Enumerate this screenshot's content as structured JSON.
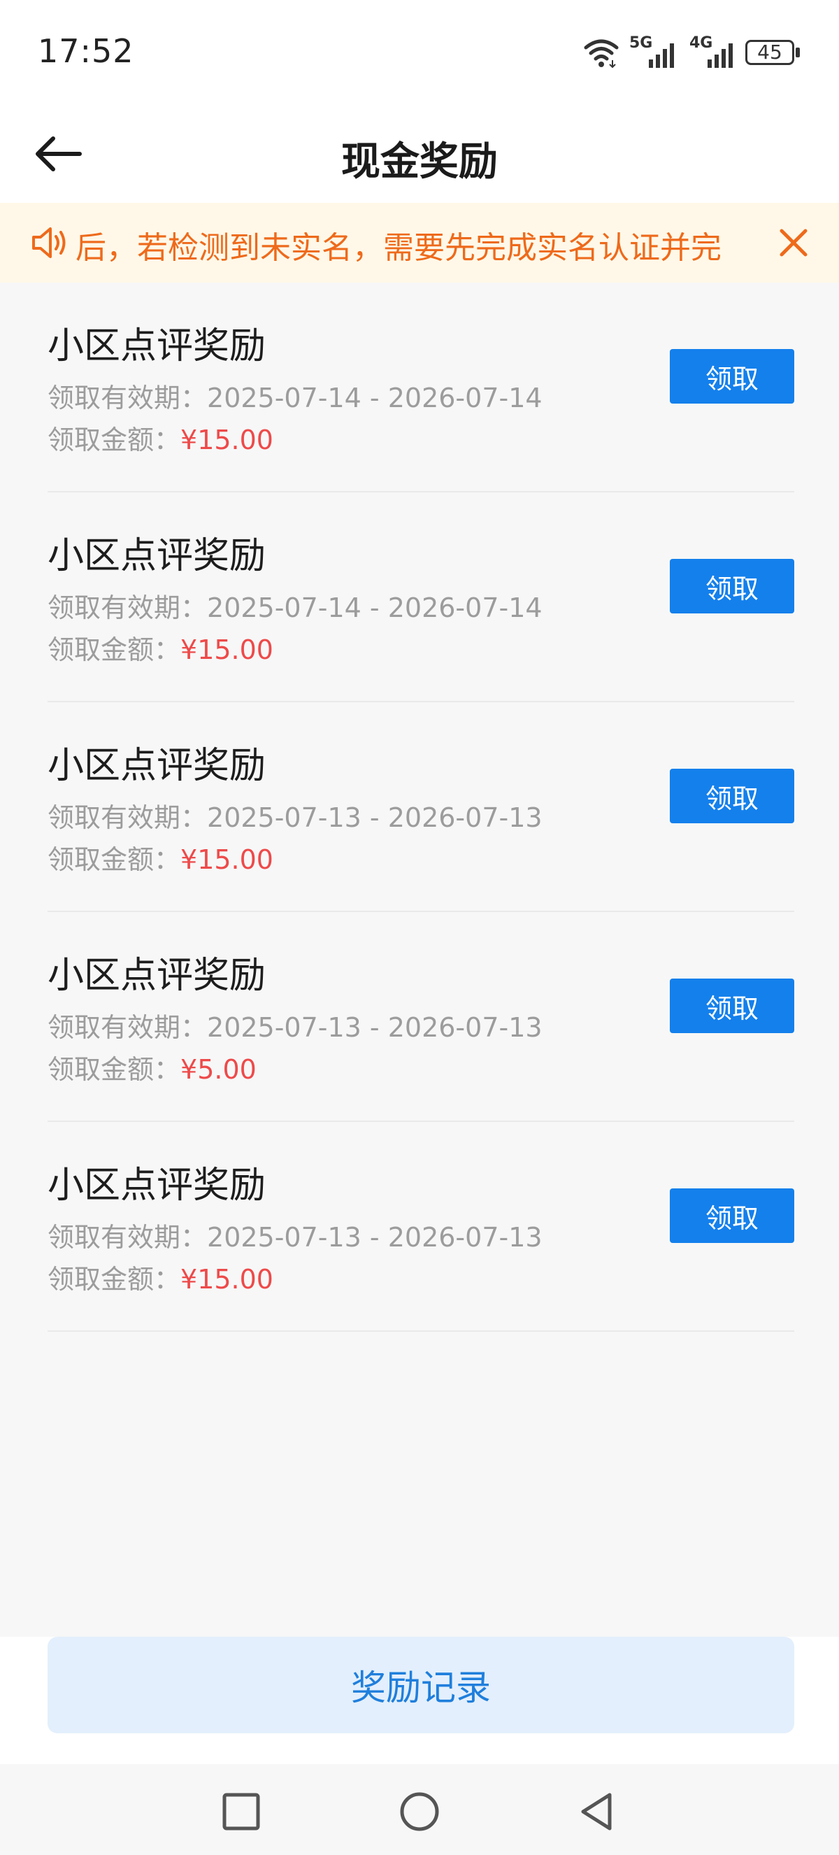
{
  "status": {
    "time": "17:52",
    "network_1": "5G",
    "network_2": "4G",
    "battery": "45"
  },
  "header": {
    "title": "现金奖励"
  },
  "notice": {
    "text": "后，若检测到未实名，需要先完成实名认证并完"
  },
  "rewards": [
    {
      "title": "小区点评奖励",
      "validity_label": "领取有效期：",
      "validity": "2025-07-14 - 2026-07-14",
      "amount_label": "领取金额：",
      "amount": "¥15.00",
      "button": "领取"
    },
    {
      "title": "小区点评奖励",
      "validity_label": "领取有效期：",
      "validity": "2025-07-14 - 2026-07-14",
      "amount_label": "领取金额：",
      "amount": "¥15.00",
      "button": "领取"
    },
    {
      "title": "小区点评奖励",
      "validity_label": "领取有效期：",
      "validity": "2025-07-13 - 2026-07-13",
      "amount_label": "领取金额：",
      "amount": "¥15.00",
      "button": "领取"
    },
    {
      "title": "小区点评奖励",
      "validity_label": "领取有效期：",
      "validity": "2025-07-13 - 2026-07-13",
      "amount_label": "领取金额：",
      "amount": "¥5.00",
      "button": "领取"
    },
    {
      "title": "小区点评奖励",
      "validity_label": "领取有效期：",
      "validity": "2025-07-13 - 2026-07-13",
      "amount_label": "领取金额：",
      "amount": "¥15.00",
      "button": "领取"
    }
  ],
  "footer": {
    "records_button": "奖励记录"
  },
  "colors": {
    "accent": "#1480ec",
    "amount": "#ee4a4a",
    "notice_text": "#ee6a1b",
    "notice_bg": "#fff8e8"
  },
  "icons": {
    "back": "back-arrow-icon",
    "notice": "speaker-icon",
    "close": "close-icon",
    "wifi": "wifi-icon",
    "signal": "signal-icon",
    "battery": "battery-icon",
    "home": "circle-home-icon",
    "recents": "square-recents-icon",
    "nav_back": "triangle-back-icon"
  }
}
